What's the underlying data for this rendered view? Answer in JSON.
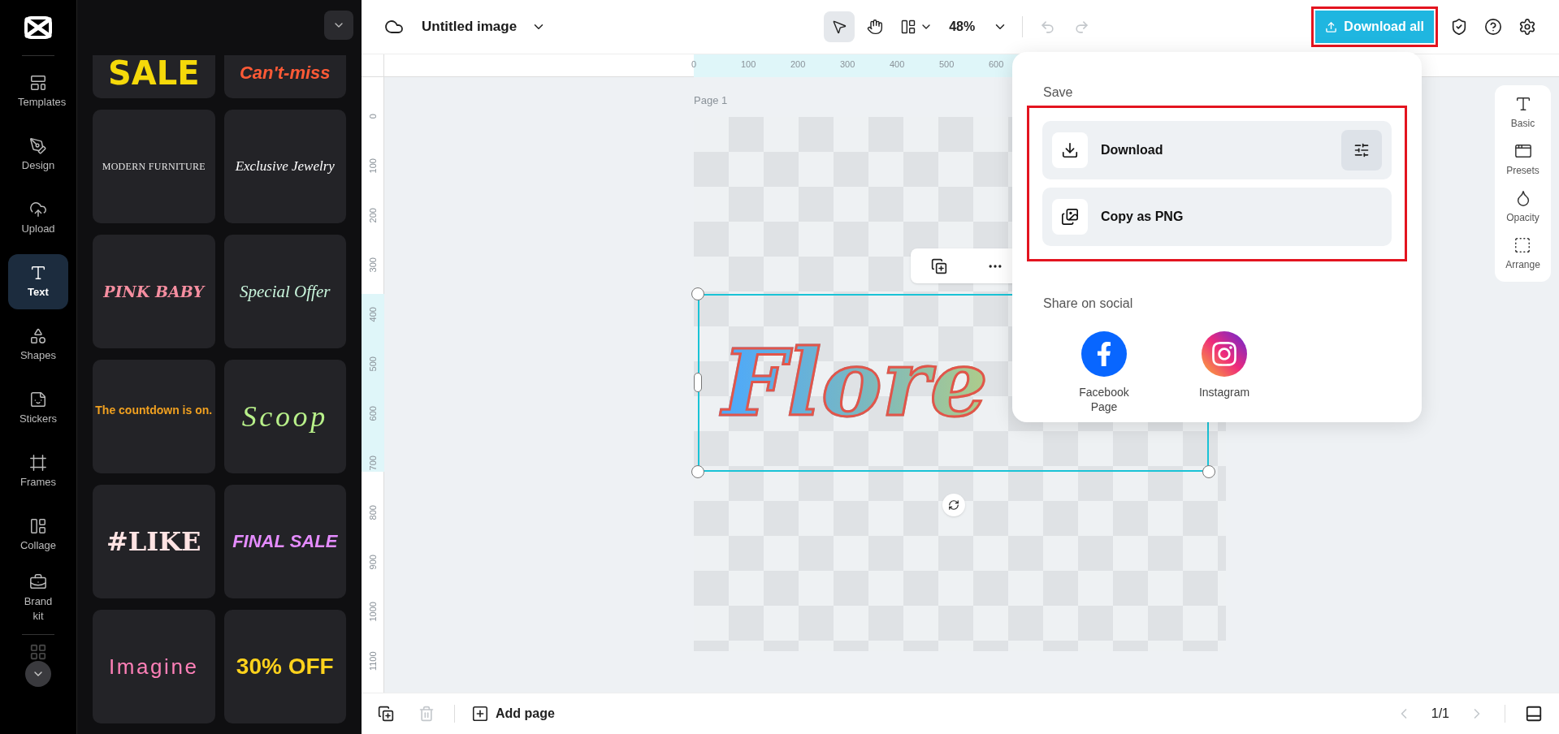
{
  "rail": {
    "items": [
      {
        "label": "Templates",
        "selected": false
      },
      {
        "label": "Design",
        "selected": false
      },
      {
        "label": "Upload",
        "selected": false
      },
      {
        "label": "Text",
        "selected": true
      },
      {
        "label": "Shapes",
        "selected": false
      },
      {
        "label": "Stickers",
        "selected": false
      },
      {
        "label": "Frames",
        "selected": false
      },
      {
        "label": "Collage",
        "selected": false
      },
      {
        "label": "Brand kit",
        "selected": false
      }
    ]
  },
  "text_presets": [
    "SALE",
    "Can't-miss",
    "MODERN FURNITURE",
    "Exclusive Jewelry",
    "PINK BABY",
    "Special Offer",
    "The countdown is on.",
    "Scoop",
    "#LIKE",
    "FINAL SALE",
    "Imagine",
    "30% OFF"
  ],
  "topbar": {
    "title": "Untitled image",
    "tools": [
      {
        "kind": "select",
        "selected": true
      },
      {
        "kind": "hand",
        "selected": false
      }
    ],
    "zoom": "48%",
    "undo": {
      "disabled": true
    },
    "redo": {
      "disabled": true
    },
    "download_all": {
      "label": "Download all",
      "highlighted": true
    }
  },
  "ruler": {
    "horizontal": [
      "0",
      "100",
      "200",
      "300",
      "400",
      "500",
      "600"
    ],
    "vertical": [
      "0",
      "100",
      "200",
      "300",
      "400",
      "500",
      "600",
      "700",
      "800",
      "900",
      "1000",
      "1100"
    ]
  },
  "canvas": {
    "page_label": "Page 1",
    "text": "Flore"
  },
  "side_tools": [
    "Basic",
    "Presets",
    "Opacity",
    "Arrange"
  ],
  "popup": {
    "save_title": "Save",
    "highlighted": true,
    "actions": [
      {
        "kind": "download",
        "label": "Download"
      },
      {
        "kind": "copy",
        "label": "Copy as PNG"
      }
    ],
    "share_title": "Share on social",
    "social": [
      {
        "kind": "facebook",
        "label": "Facebook Page"
      },
      {
        "kind": "instagram",
        "label": "Instagram"
      }
    ]
  },
  "bottombar": {
    "delete": {
      "disabled": true
    },
    "add_page": "Add page",
    "pager": "1/1",
    "prev": {
      "disabled": true
    },
    "next": {
      "disabled": true
    }
  }
}
